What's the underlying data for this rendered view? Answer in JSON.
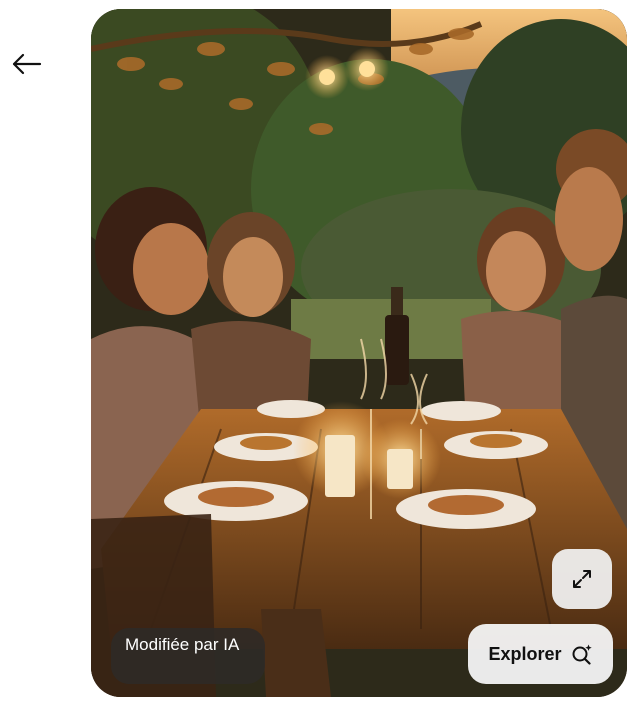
{
  "navigation": {
    "back_icon": "arrow-left-icon"
  },
  "image": {
    "alt": "Quatre amis dînant à la bougie sur une table en bois en plein air au coucher du soleil",
    "badge_label": "Modifiée par IA"
  },
  "actions": {
    "expand_icon": "expand-arrows-icon",
    "explore_label": "Explorer",
    "explore_icon": "visual-search-sparkle-icon"
  }
}
